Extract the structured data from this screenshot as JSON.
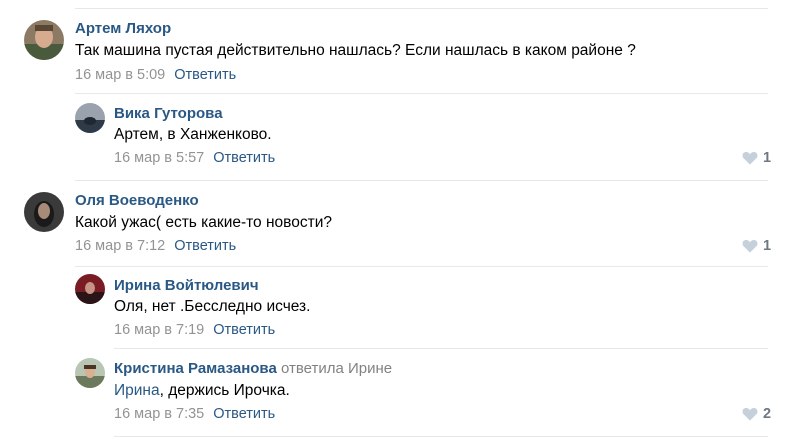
{
  "comments": [
    {
      "author": "Артем Ляхор",
      "text": "Так машина пустая действительно нашлась? Если нашлась в каком районе ?",
      "date": "16 мар в 5:09",
      "reply": "Ответить",
      "likes": ""
    },
    {
      "author": "Вика Гуторова",
      "text": "Артем, в Ханженково.",
      "date": "16 мар в 5:57",
      "reply": "Ответить",
      "likes": "1"
    },
    {
      "author": "Оля Воеводенко",
      "text": "Какой ужас( есть какие-то новости?",
      "date": "16 мар в 7:12",
      "reply": "Ответить",
      "likes": "1"
    },
    {
      "author": "Ирина Войтюлевич",
      "text": "Оля, нет .Бесследно исчез.",
      "date": "16 мар в 7:19",
      "reply": "Ответить",
      "likes": ""
    },
    {
      "author": "Кристина Рамазанова",
      "replied_to": "ответила Ирине",
      "mention": "Ирина",
      "text": ", держись Ирочка.",
      "date": "16 мар в 7:35",
      "reply": "Ответить",
      "likes": "2"
    }
  ],
  "icons": {
    "like": "heart-icon"
  },
  "colors": {
    "link": "#2a5885",
    "muted": "#939393",
    "divider": "#e7e8ec",
    "like_icon": "#c5d0db"
  }
}
